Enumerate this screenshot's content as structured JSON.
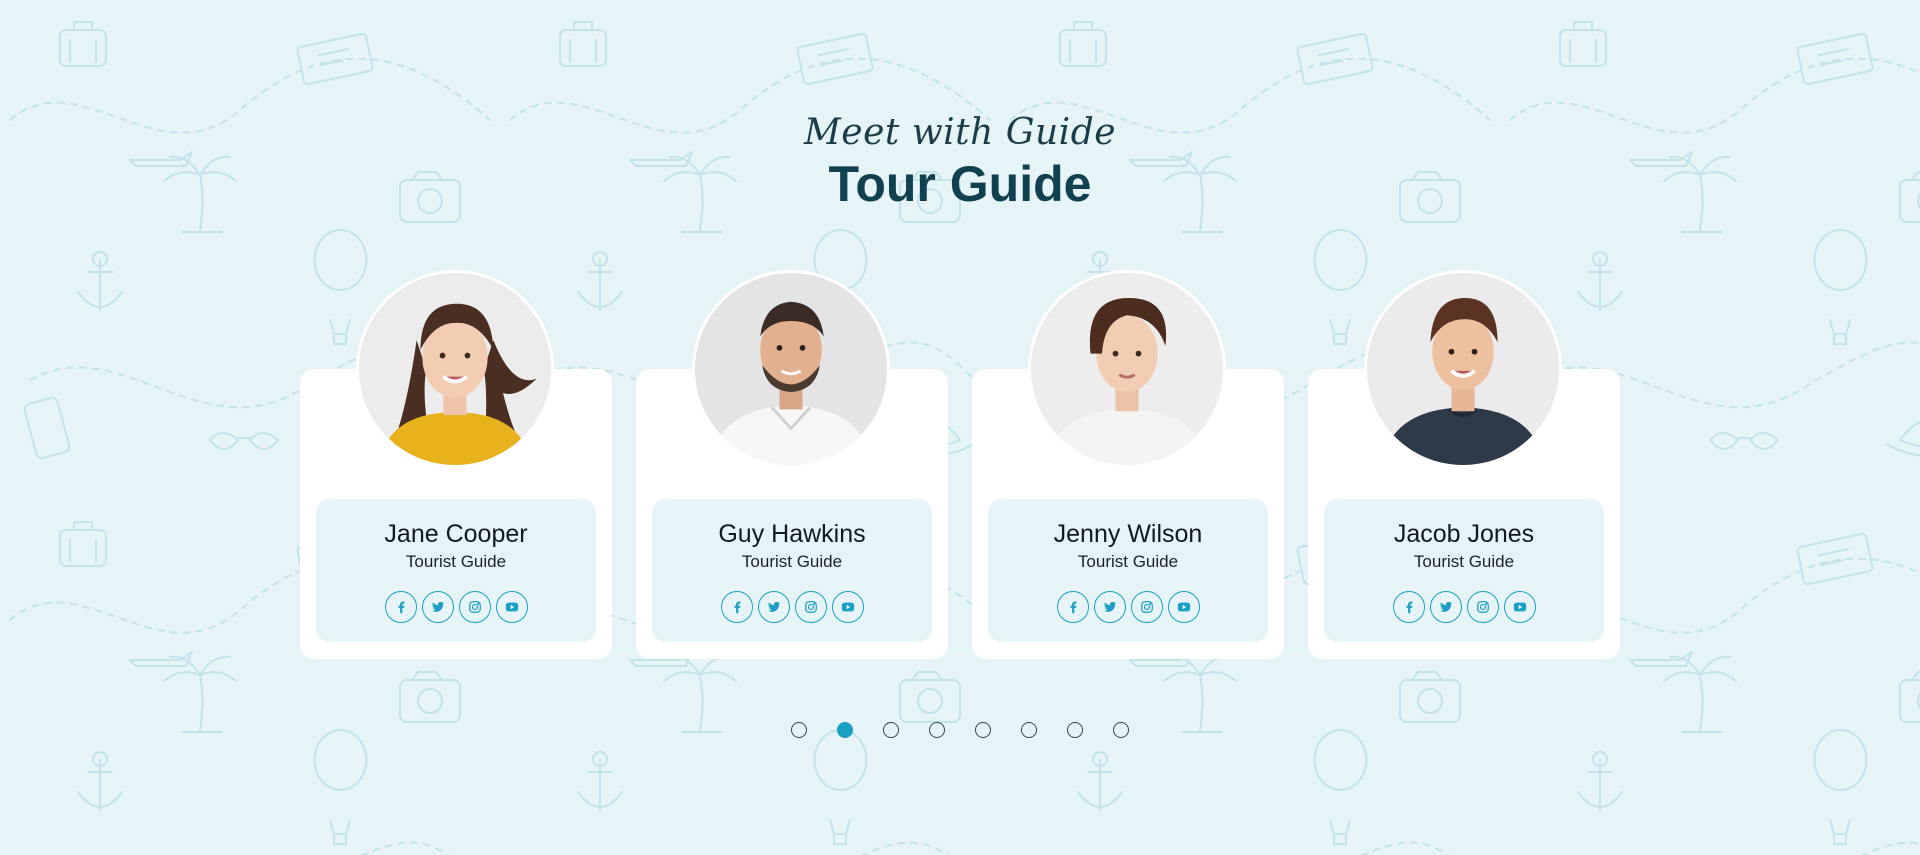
{
  "section": {
    "subtitle": "Meet with Guide",
    "title": "Tour Guide"
  },
  "colors": {
    "background": "#e6f4f8",
    "accent": "#1aa0c4",
    "title": "#11404e",
    "card": "#ffffff",
    "info_panel": "#e6f4f8"
  },
  "guides": [
    {
      "name": "Jane Cooper",
      "role": "Tourist Guide",
      "photo": "woman-yellow-top"
    },
    {
      "name": "Guy Hawkins",
      "role": "Tourist Guide",
      "photo": "man-white-shirt"
    },
    {
      "name": "Jenny Wilson",
      "role": "Tourist Guide",
      "photo": "woman-short-hair"
    },
    {
      "name": "Jacob Jones",
      "role": "Tourist Guide",
      "photo": "man-navy-shirt"
    }
  ],
  "social_icons": [
    "facebook-icon",
    "twitter-icon",
    "instagram-icon",
    "youtube-icon"
  ],
  "pagination": {
    "count": 8,
    "active_index": 1
  }
}
